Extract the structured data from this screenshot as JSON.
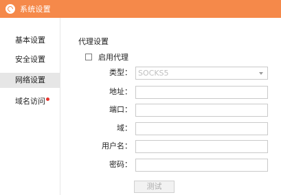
{
  "window": {
    "title": "系统设置",
    "accent": "#f5894a"
  },
  "sidebar": {
    "items": [
      {
        "label": "基本设置",
        "active": false
      },
      {
        "label": "安全设置",
        "active": false
      },
      {
        "label": "网络设置",
        "active": true
      },
      {
        "label": "域名访问",
        "active": false,
        "badge": "red-dot"
      }
    ]
  },
  "proxy": {
    "section_title": "代理设置",
    "enable_label": "启用代理",
    "enabled": false,
    "fields": {
      "type": {
        "label": "类型：",
        "value": "SOCKS5"
      },
      "address": {
        "label": "地址：",
        "value": ""
      },
      "port": {
        "label": "端口：",
        "value": ""
      },
      "domain": {
        "label": "域：",
        "value": ""
      },
      "username": {
        "label": "用户名：",
        "value": ""
      },
      "password": {
        "label": "密码：",
        "value": ""
      }
    },
    "test_label": "测试"
  }
}
